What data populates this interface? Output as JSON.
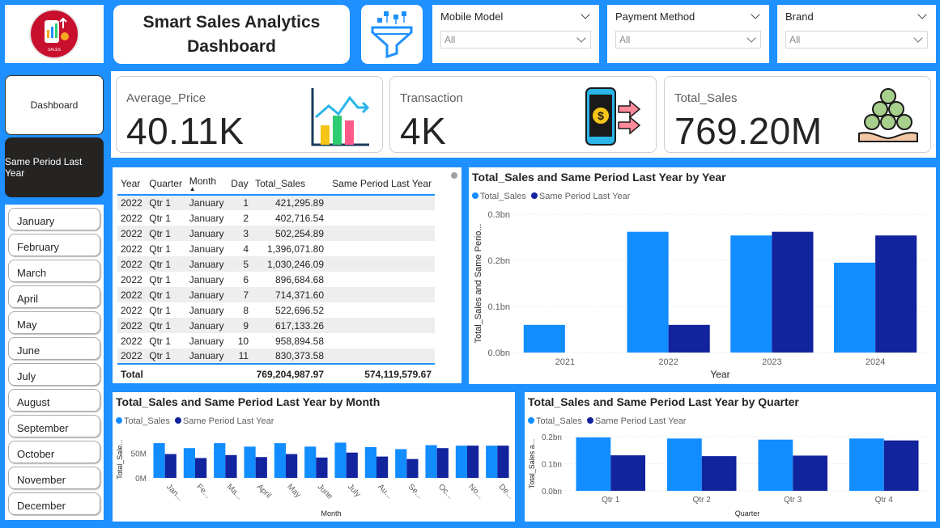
{
  "title": {
    "line1": "Smart Sales Analytics",
    "line2": "Dashboard"
  },
  "logo": {
    "text": "SALES",
    "icon": "sales-logo-icon"
  },
  "filters": [
    {
      "label": "Mobile Model",
      "value": "All"
    },
    {
      "label": "Payment Method",
      "value": "All"
    },
    {
      "label": "Brand",
      "value": "All"
    }
  ],
  "nav": {
    "dashboard": "Dashboard",
    "sply": "Same Period Last Year"
  },
  "months": [
    "January",
    "February",
    "March",
    "April",
    "May",
    "June",
    "July",
    "August",
    "September",
    "October",
    "November",
    "December"
  ],
  "kpis": [
    {
      "label": "Average_Price",
      "value": "40.11K",
      "icon": "bar-chart-icon"
    },
    {
      "label": "Transaction",
      "value": "4K",
      "icon": "mobile-payment-icon"
    },
    {
      "label": "Total_Sales",
      "value": "769.20M",
      "icon": "money-bag-hand-icon"
    }
  ],
  "colors": {
    "total_sales": "#118dff",
    "sply": "#12239e",
    "background": "#1e90ff"
  },
  "table": {
    "headers": [
      "Year",
      "Quarter",
      "Month",
      "Day",
      "Total_Sales",
      "Same Period Last Year"
    ],
    "rows": [
      [
        "2022",
        "Qtr 1",
        "January",
        "1",
        "421,295.89",
        ""
      ],
      [
        "2022",
        "Qtr 1",
        "January",
        "2",
        "402,716.54",
        ""
      ],
      [
        "2022",
        "Qtr 1",
        "January",
        "3",
        "502,254.89",
        ""
      ],
      [
        "2022",
        "Qtr 1",
        "January",
        "4",
        "1,396,071.80",
        ""
      ],
      [
        "2022",
        "Qtr 1",
        "January",
        "5",
        "1,030,246.09",
        ""
      ],
      [
        "2022",
        "Qtr 1",
        "January",
        "6",
        "896,684.68",
        ""
      ],
      [
        "2022",
        "Qtr 1",
        "January",
        "7",
        "714,371.60",
        ""
      ],
      [
        "2022",
        "Qtr 1",
        "January",
        "8",
        "522,696.52",
        ""
      ],
      [
        "2022",
        "Qtr 1",
        "January",
        "9",
        "617,133.26",
        ""
      ],
      [
        "2022",
        "Qtr 1",
        "January",
        "10",
        "958,894.58",
        ""
      ],
      [
        "2022",
        "Qtr 1",
        "January",
        "11",
        "830,373.58",
        ""
      ]
    ],
    "total": {
      "label": "Total",
      "total_sales": "769,204,987.97",
      "sply": "574,119,579.67"
    }
  },
  "chart_data": [
    {
      "type": "bar",
      "title": "Total_Sales and Same Period Last Year by Year",
      "xlabel": "Year",
      "ylabel": "Total_Sales and Same Perio...",
      "categories": [
        "2021",
        "2022",
        "2023",
        "2024"
      ],
      "yticks": [
        "0.0bn",
        "0.1bn",
        "0.2bn",
        "0.3bn"
      ],
      "ylim": [
        0,
        0.3
      ],
      "legend": "top-left",
      "series": [
        {
          "name": "Total_Sales",
          "values": [
            0.06,
            0.262,
            0.254,
            0.195
          ]
        },
        {
          "name": "Same Period Last Year",
          "values": [
            0,
            0.06,
            0.262,
            0.254
          ]
        }
      ]
    },
    {
      "type": "bar",
      "title": "Total_Sales and Same Period Last Year by Month",
      "xlabel": "Month",
      "ylabel": "Total_Sale...",
      "categories": [
        "Jan...",
        "Fe...",
        "Ma...",
        "April",
        "May",
        "June",
        "July",
        "Au...",
        "Se...",
        "Oc...",
        "No...",
        "De..."
      ],
      "yticks": [
        "0M",
        "50M"
      ],
      "ylim": [
        0,
        75
      ],
      "legend": "top-left",
      "series": [
        {
          "name": "Total_Sales",
          "values": [
            70,
            60,
            70,
            63,
            70,
            63,
            71,
            62,
            58,
            66,
            65,
            65
          ]
        },
        {
          "name": "Same Period Last Year",
          "values": [
            48,
            40,
            46,
            42,
            48,
            41,
            51,
            43,
            38,
            60,
            65,
            65
          ]
        }
      ]
    },
    {
      "type": "bar",
      "title": "Total_Sales and Same Period Last Year by Quarter",
      "xlabel": "Quarter",
      "ylabel": "Total_Sales a...",
      "categories": [
        "Qtr 1",
        "Qtr 2",
        "Qtr 3",
        "Qtr 4"
      ],
      "yticks": [
        "0.0bn",
        "0.1bn",
        "0.2bn"
      ],
      "ylim": [
        0,
        0.2
      ],
      "legend": "top-left",
      "series": [
        {
          "name": "Total_Sales",
          "values": [
            0.197,
            0.193,
            0.189,
            0.193
          ]
        },
        {
          "name": "Same Period Last Year",
          "values": [
            0.131,
            0.128,
            0.13,
            0.186
          ]
        }
      ]
    }
  ]
}
